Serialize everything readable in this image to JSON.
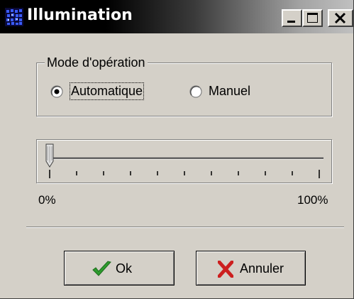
{
  "window": {
    "title": "Illumination",
    "app_icon": "illumination-grid-icon",
    "controls": [
      "minimize-icon",
      "maximize-icon",
      "close-icon"
    ]
  },
  "mode_group": {
    "legend": "Mode d'opération",
    "options": [
      {
        "label": "Automatique",
        "selected": true
      },
      {
        "label": "Manuel",
        "selected": false
      }
    ]
  },
  "slider": {
    "min_label": "0%",
    "max_label": "100%",
    "value_percent": 0,
    "tick_count": 11
  },
  "buttons": {
    "ok_label": "Ok",
    "ok_icon": "checkmark-icon",
    "cancel_label": "Annuler",
    "cancel_icon": "red-x-icon"
  },
  "colors": {
    "face": "#d4d0c8",
    "check_green": "#2e9b2e",
    "cancel_red": "#cc1f1f",
    "app_icon_blue": "#2a3fd6"
  }
}
